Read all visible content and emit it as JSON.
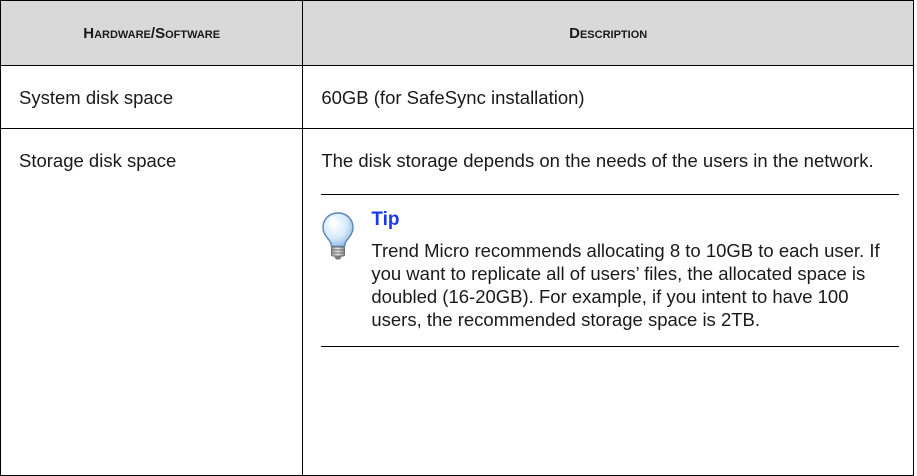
{
  "table": {
    "headers": {
      "hardware_software": "Hardware/Software",
      "description": "Description"
    },
    "rows": [
      {
        "item": "System disk space",
        "description": "60GB (for SafeSync installation)"
      },
      {
        "item": "Storage disk space",
        "description": "The disk storage depends on the needs of the users in the network.",
        "tip": {
          "icon": "lightbulb-icon",
          "title": "Tip",
          "text": "Trend Micro recommends allocating 8 to 10GB to each user. If you want to replicate all of users’ files, the allocated space is doubled (16-20GB). For example, if you intent to have 100 users, the recommended storage space is 2TB."
        }
      }
    ]
  },
  "colors": {
    "header_bg": "#d9d9d9",
    "border": "#000000",
    "tip_title": "#1a39e8",
    "text": "#1a1a1a"
  }
}
